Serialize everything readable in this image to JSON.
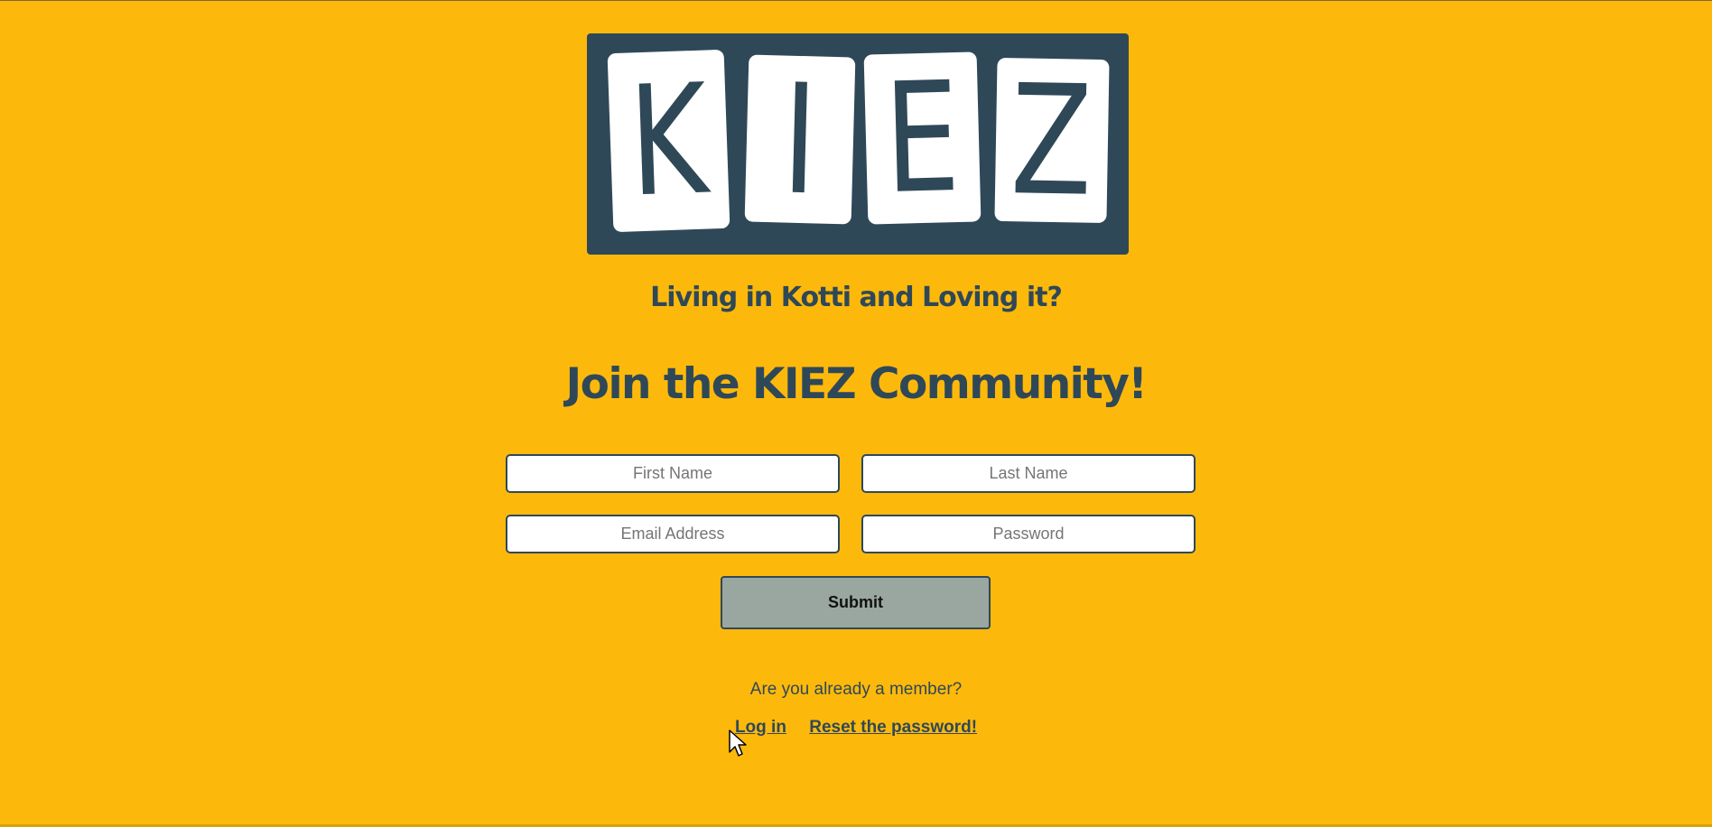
{
  "logo": {
    "letters": [
      "K",
      "I",
      "E",
      "Z"
    ]
  },
  "tagline": "Living in Kotti and Loving it?",
  "headline": "Join the KIEZ Community!",
  "form": {
    "first_name_placeholder": "First Name",
    "last_name_placeholder": "Last Name",
    "email_placeholder": "Email Address",
    "password_placeholder": "Password",
    "submit_label": "Submit"
  },
  "member_question": "Are you already a member?",
  "links": {
    "login": "Log in",
    "reset": "Reset the password!"
  },
  "colors": {
    "background": "#FDB90B",
    "brand_dark": "#2F4858",
    "submit_bg": "#9AA6A0"
  },
  "icons": {
    "cursor": "mouse-pointer-icon"
  }
}
